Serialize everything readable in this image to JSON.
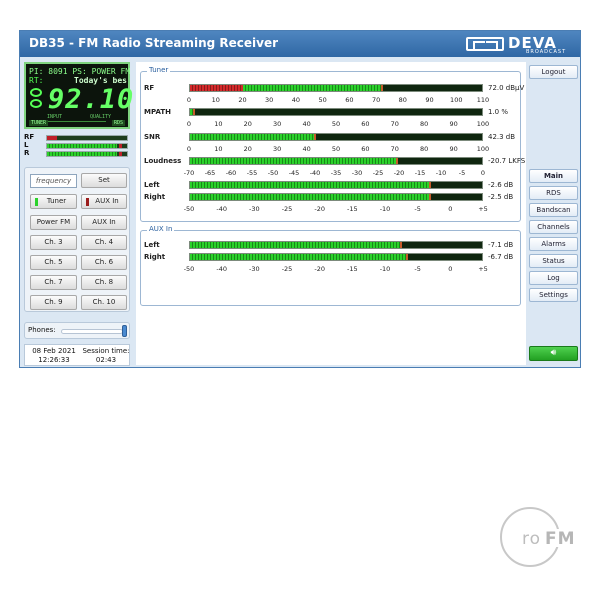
{
  "app": {
    "title": "DB35 - FM Radio Streaming Receiver",
    "brand": {
      "name": "DEVA",
      "tagline": "BROADCAST"
    }
  },
  "lcd": {
    "line1": "PI: 8091 PS: POWER  FM",
    "rt_label": "RT:",
    "rt_text": "Today's bes",
    "frequency": "92.10",
    "input_label": "INPUT",
    "quality_label": "QUALITY",
    "tuner_badge": "TUNER",
    "rds_badge": "RDS"
  },
  "mini_meters": [
    {
      "label": "RF",
      "level": 0.1,
      "peak": true
    },
    {
      "label": "L",
      "level": 0.88,
      "peak": true
    },
    {
      "label": "R",
      "level": 0.88,
      "peak": true
    }
  ],
  "controls": {
    "frequency_placeholder": "frequency",
    "set_label": "Set",
    "tuner_label": "Tuner",
    "aux_in_label": "AUX In",
    "power_fm_label": "Power FM",
    "aux_in_preset_label": "AUX In",
    "channels": [
      "Ch. 3",
      "Ch. 4",
      "Ch. 5",
      "Ch. 6",
      "Ch. 7",
      "Ch. 8",
      "Ch. 9",
      "Ch. 10"
    ]
  },
  "phones": {
    "label": "Phones:",
    "volume": 1.0
  },
  "status": {
    "date": "08 Feb 2021",
    "time": "12:26:33",
    "session_label": "Session time:",
    "session_time": "02:43"
  },
  "tuner": {
    "legend": "Tuner",
    "rf": {
      "label": "RF",
      "value": "72.0 dBµV",
      "level": 0.654,
      "red_until": 0.18
    },
    "mpath": {
      "label": "MPATH",
      "value": "1.0 %",
      "level": 0.01
    },
    "snr": {
      "label": "SNR",
      "value": "42.3 dB",
      "level": 0.423
    },
    "loudness": {
      "label": "Loudness",
      "value": "-20.7 LKFS",
      "level": 0.704
    },
    "left": {
      "label": "Left",
      "value": "-2.6 dB",
      "level": 0.82
    },
    "right": {
      "label": "Right",
      "value": "-2.5 dB",
      "level": 0.82
    },
    "scale_rf": [
      "0",
      "10",
      "20",
      "30",
      "40",
      "50",
      "60",
      "70",
      "80",
      "90",
      "100",
      "110"
    ],
    "scale_pct": [
      "0",
      "10",
      "20",
      "30",
      "40",
      "50",
      "60",
      "70",
      "80",
      "90",
      "100"
    ],
    "scale_snr": [
      "0",
      "10",
      "20",
      "30",
      "40",
      "50",
      "60",
      "70",
      "80",
      "90",
      "100"
    ],
    "scale_loud": [
      "-70",
      "-65",
      "-60",
      "-55",
      "-50",
      "-45",
      "-40",
      "-35",
      "-30",
      "-25",
      "-20",
      "-15",
      "-10",
      "-5",
      "0"
    ],
    "scale_db": [
      "-50",
      "-40",
      "-30",
      "-25",
      "-20",
      "-15",
      "-10",
      "-5",
      "0",
      "+5"
    ]
  },
  "aux": {
    "legend": "AUX In",
    "left": {
      "label": "Left",
      "value": "-7.1 dB",
      "level": 0.72
    },
    "right": {
      "label": "Right",
      "value": "-6.7 dB",
      "level": 0.74
    },
    "scale_db": [
      "-50",
      "-40",
      "-30",
      "-25",
      "-20",
      "-15",
      "-10",
      "-5",
      "0",
      "+5"
    ]
  },
  "nav": {
    "logout": "Logout",
    "items": [
      "Main",
      "RDS",
      "Bandscan",
      "Channels",
      "Alarms",
      "Status",
      "Log",
      "Settings"
    ],
    "active": "Main"
  },
  "watermark": {
    "prefix": "ro",
    "brand": "FM"
  },
  "colors": {
    "accent": "#2f67a4",
    "meter_green": "#2bd22b",
    "meter_red": "#c0202a",
    "lcd_green": "#55ff55"
  }
}
